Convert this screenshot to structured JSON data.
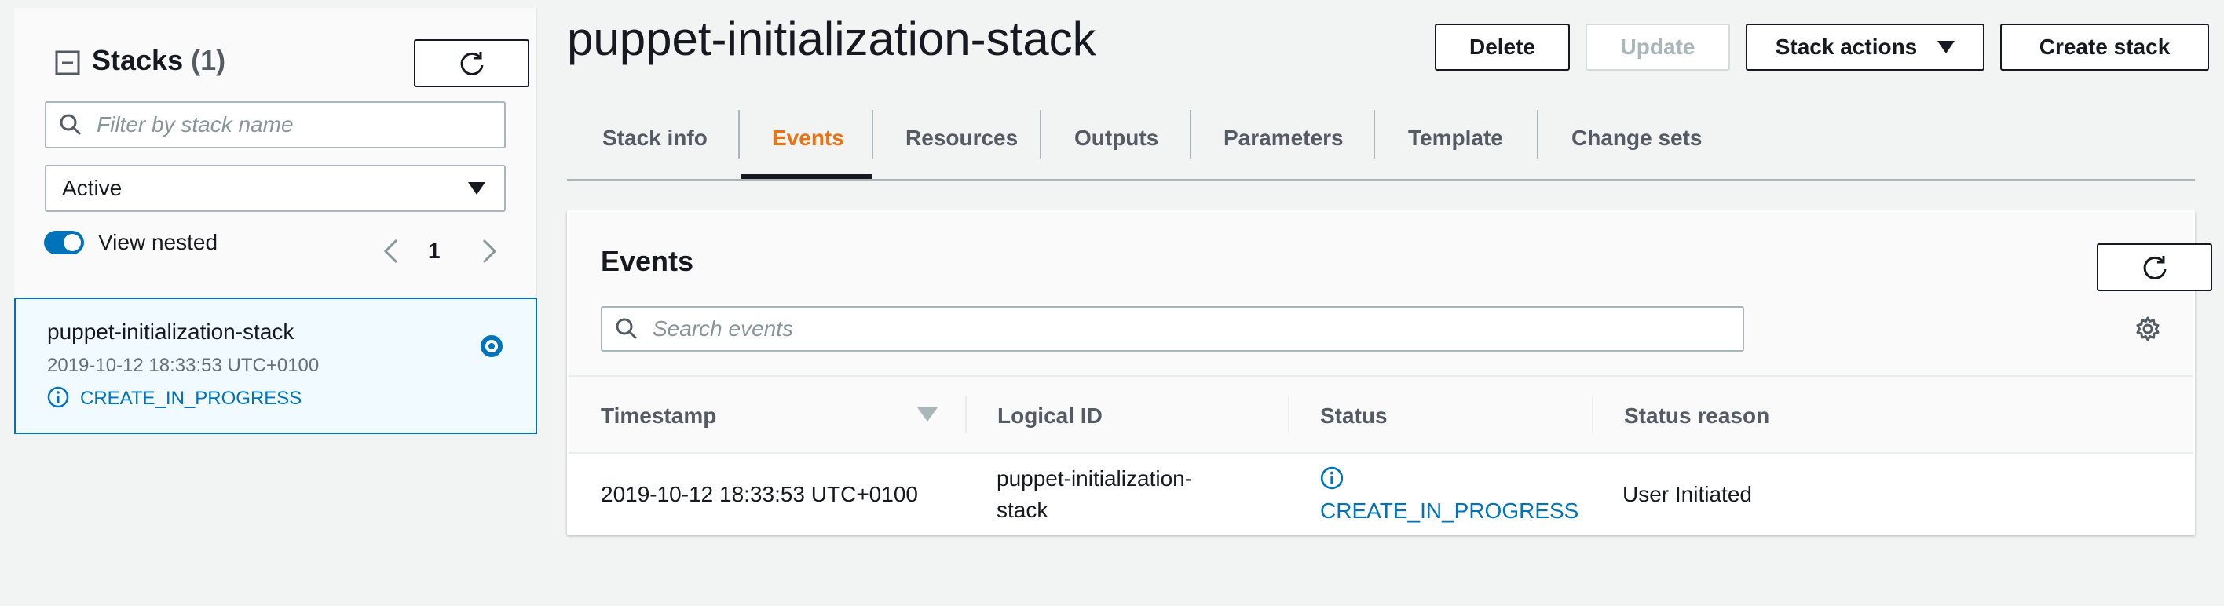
{
  "sidebar": {
    "title": "Stacks",
    "count": "(1)",
    "filter_placeholder": "Filter by stack name",
    "status_filter": "Active",
    "view_nested_label": "View nested",
    "view_nested_on": true,
    "page": "1",
    "stacks": [
      {
        "name": "puppet-initialization-stack",
        "timestamp": "2019-10-12 18:33:53 UTC+0100",
        "status": "CREATE_IN_PROGRESS",
        "selected": true
      }
    ]
  },
  "header": {
    "title": "puppet-initialization-stack",
    "buttons": {
      "delete": "Delete",
      "update": "Update",
      "stack_actions": "Stack actions",
      "create_stack": "Create stack"
    }
  },
  "tabs": [
    {
      "label": "Stack info",
      "active": false
    },
    {
      "label": "Events",
      "active": true
    },
    {
      "label": "Resources",
      "active": false
    },
    {
      "label": "Outputs",
      "active": false
    },
    {
      "label": "Parameters",
      "active": false
    },
    {
      "label": "Template",
      "active": false
    },
    {
      "label": "Change sets",
      "active": false
    }
  ],
  "events": {
    "title": "Events",
    "search_placeholder": "Search events",
    "columns": [
      "Timestamp",
      "Logical ID",
      "Status",
      "Status reason"
    ],
    "rows": [
      {
        "timestamp": "2019-10-12 18:33:53 UTC+0100",
        "logical_id_line1": "puppet-initialization-",
        "logical_id_line2": "stack",
        "status": "CREATE_IN_PROGRESS",
        "status_reason": "User Initiated"
      }
    ]
  },
  "colors": {
    "accent": "#ec7211",
    "link": "#0073bb",
    "background": "#f2f3f3"
  }
}
